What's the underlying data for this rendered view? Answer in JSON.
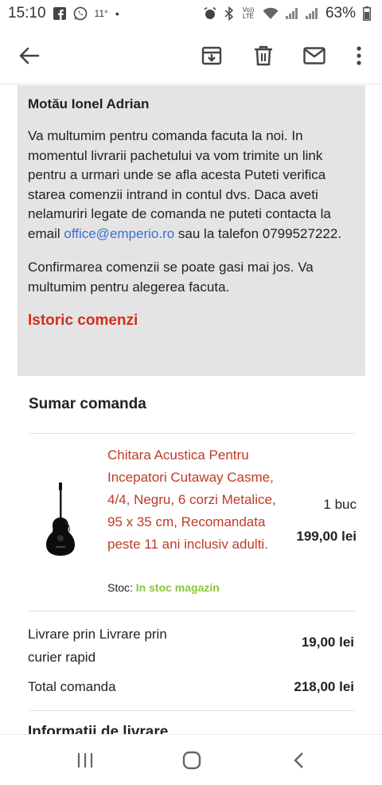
{
  "status": {
    "time": "15:10",
    "temp": "11°",
    "volte": "Vo)) LTE",
    "battery": "63%"
  },
  "toolbar": {
    "back_icon": "arrow-back-icon",
    "archive_icon": "archive-icon",
    "delete_icon": "trash-icon",
    "mark_icon": "mail-icon",
    "more_icon": "more-vert-icon"
  },
  "message": {
    "name": "Motău Ionel Adrian",
    "para1_text": "Va multumim pentru comanda facuta la noi. In momentul livrarii pachetului va vom trimite un link pentru a urmari unde se afla acesta Puteti verifica starea comenzii intrand in contul dvs. Daca aveti nelamuriri legate de comanda ne puteti contacta la email ",
    "email": "office@emperio.ro",
    "para1_tail": " sau la talefon 0799527222.",
    "para2": "Confirmarea comenzii se poate gasi mai jos. Va multumim pentru alegerea facuta.",
    "history_link": "Istoric comenzi"
  },
  "summary": {
    "title": "Sumar comanda",
    "product": {
      "name": "Chitara Acustica Pentru Incepatori Cutaway Casme, 4/4, Negru, 6 corzi Metalice, 95 x 35 cm, Recomandata peste 11 ani inclusiv adulti.",
      "qty": "1 buc",
      "price": "199,00 lei",
      "stock_label": "Stoc: ",
      "stock_value": "In stoc magazin"
    },
    "shipping_label": "Livrare prin Livrare prin curier rapid",
    "shipping_price": "19,00 lei",
    "total_label": "Total comanda",
    "total_price": "218,00 lei",
    "next_section": "Informatii de livrare"
  },
  "colors": {
    "accent_red": "#c03a28",
    "link_blue": "#3b6fd3",
    "stock_green": "#8bc43f",
    "card_bg": "#e4e4e4"
  }
}
